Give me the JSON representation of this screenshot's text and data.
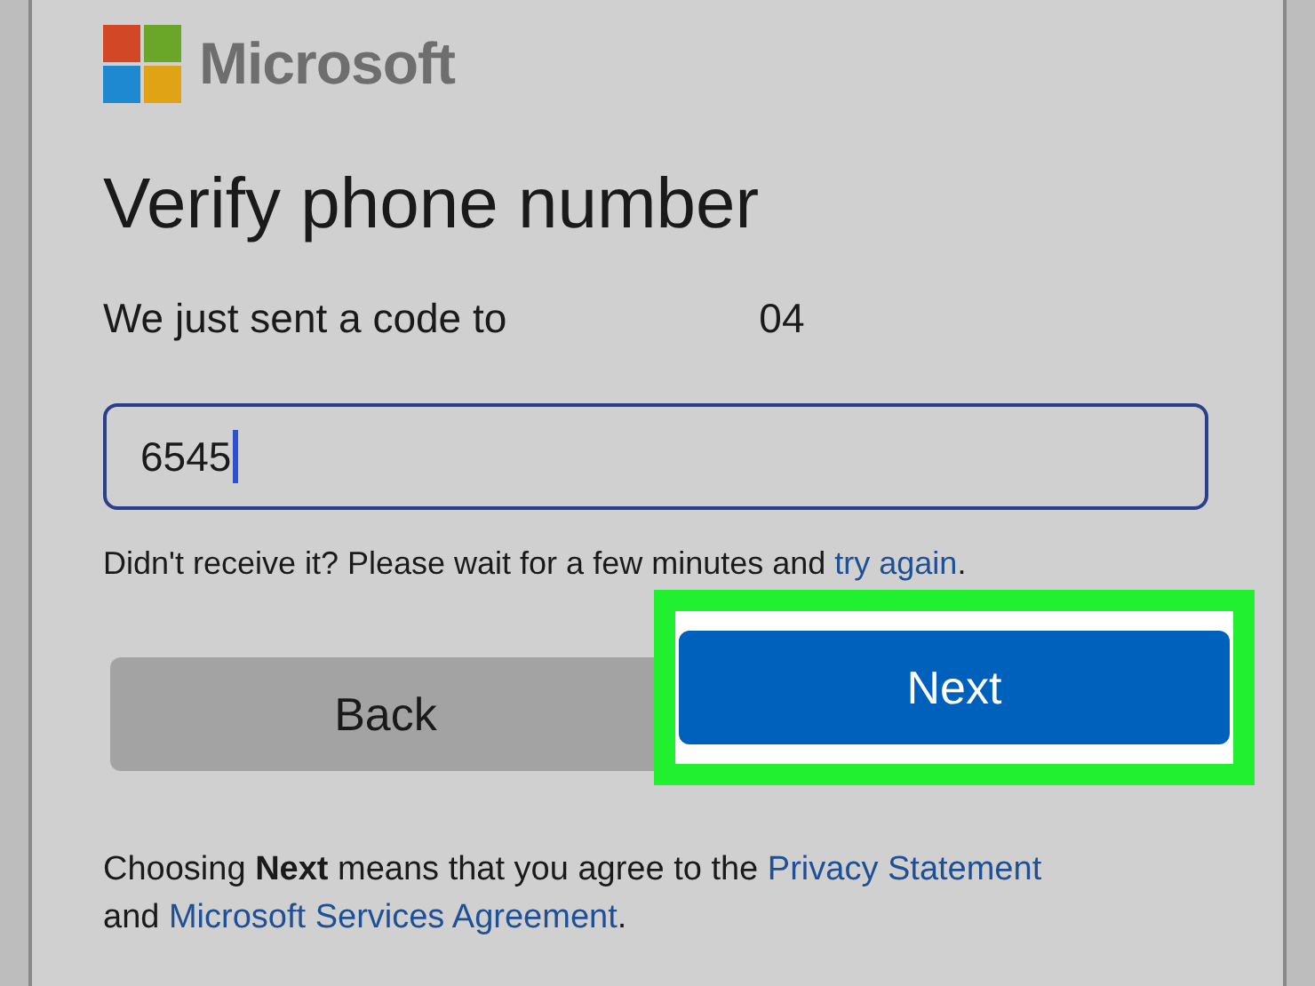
{
  "brand": {
    "name": "Microsoft"
  },
  "title": "Verify phone number",
  "sent_notice": {
    "text": "We just sent a code to",
    "number_end": "04"
  },
  "code_field": {
    "value": "6545",
    "focused": true
  },
  "resend_notice": {
    "text": "Didn't receive it? Please wait for a few minutes and ",
    "link": "try again",
    "end": "."
  },
  "buttons": [
    {
      "label": "Back",
      "kind": "secondary",
      "highlighted": false
    },
    {
      "label": "Next",
      "kind": "primary",
      "highlighted": true
    }
  ],
  "terms": {
    "text": "Choosing **Next** means that you agree to the ",
    "link1": "Privacy Statement",
    "between": " and ",
    "link2": "Microsoft Services Agreement",
    "end": "."
  }
}
